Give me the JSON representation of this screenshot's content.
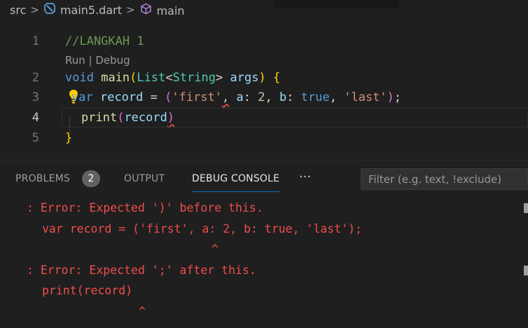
{
  "breadcrumb": {
    "items": [
      {
        "label": "src",
        "icon": ""
      },
      {
        "label": "main5.dart",
        "icon": "dart-file-icon"
      },
      {
        "label": "main",
        "icon": "function-cube-icon"
      }
    ],
    "separator": ">"
  },
  "editor": {
    "codelens": {
      "run": "Run",
      "sep": " | ",
      "debug": "Debug"
    },
    "lines": [
      {
        "num": "1",
        "comment": "//LANGKAH 1"
      },
      {
        "num": "2",
        "kw_void": "void",
        "fn_main": "main",
        "p_open": "(",
        "type_list": "List",
        "lt": "<",
        "type_string": "String",
        "gt": ">",
        "var_args": "args",
        "p_close": ")",
        "brace": "{"
      },
      {
        "num": "3",
        "kw_var": "var",
        "var_record": "record",
        "eq": "=",
        "p_open": "(",
        "str_first": "'first'",
        "comma1": ",",
        "named_a": "a",
        "colon_a": ":",
        "num_2": "2",
        "comma2": ",",
        "named_b": "b",
        "colon_b": ":",
        "kw_true": "true",
        "comma3": ",",
        "str_last": "'last'",
        "p_close": ")",
        "semi": ";"
      },
      {
        "num": "4",
        "fn_print": "print",
        "p_open": "(",
        "var_record": "record",
        "p_close": ")"
      },
      {
        "num": "5",
        "brace": "}"
      }
    ]
  },
  "panel": {
    "tabs": [
      {
        "label": "PROBLEMS",
        "badge": "2"
      },
      {
        "label": "OUTPUT"
      },
      {
        "label": "DEBUG CONSOLE",
        "active": true
      }
    ],
    "more": "···",
    "filter_placeholder": "Filter (e.g. text, !exclude)"
  },
  "console": {
    "lines": [
      ": Error: Expected ')' before this.",
      "var record = ('first', a: 2, b: true, 'last');",
      "^",
      ": Error: Expected ';' after this.",
      "print(record)",
      "^"
    ]
  },
  "colors": {
    "background": "#1f1f1f",
    "error": "#f14c4c",
    "accent": "#0078d4"
  }
}
